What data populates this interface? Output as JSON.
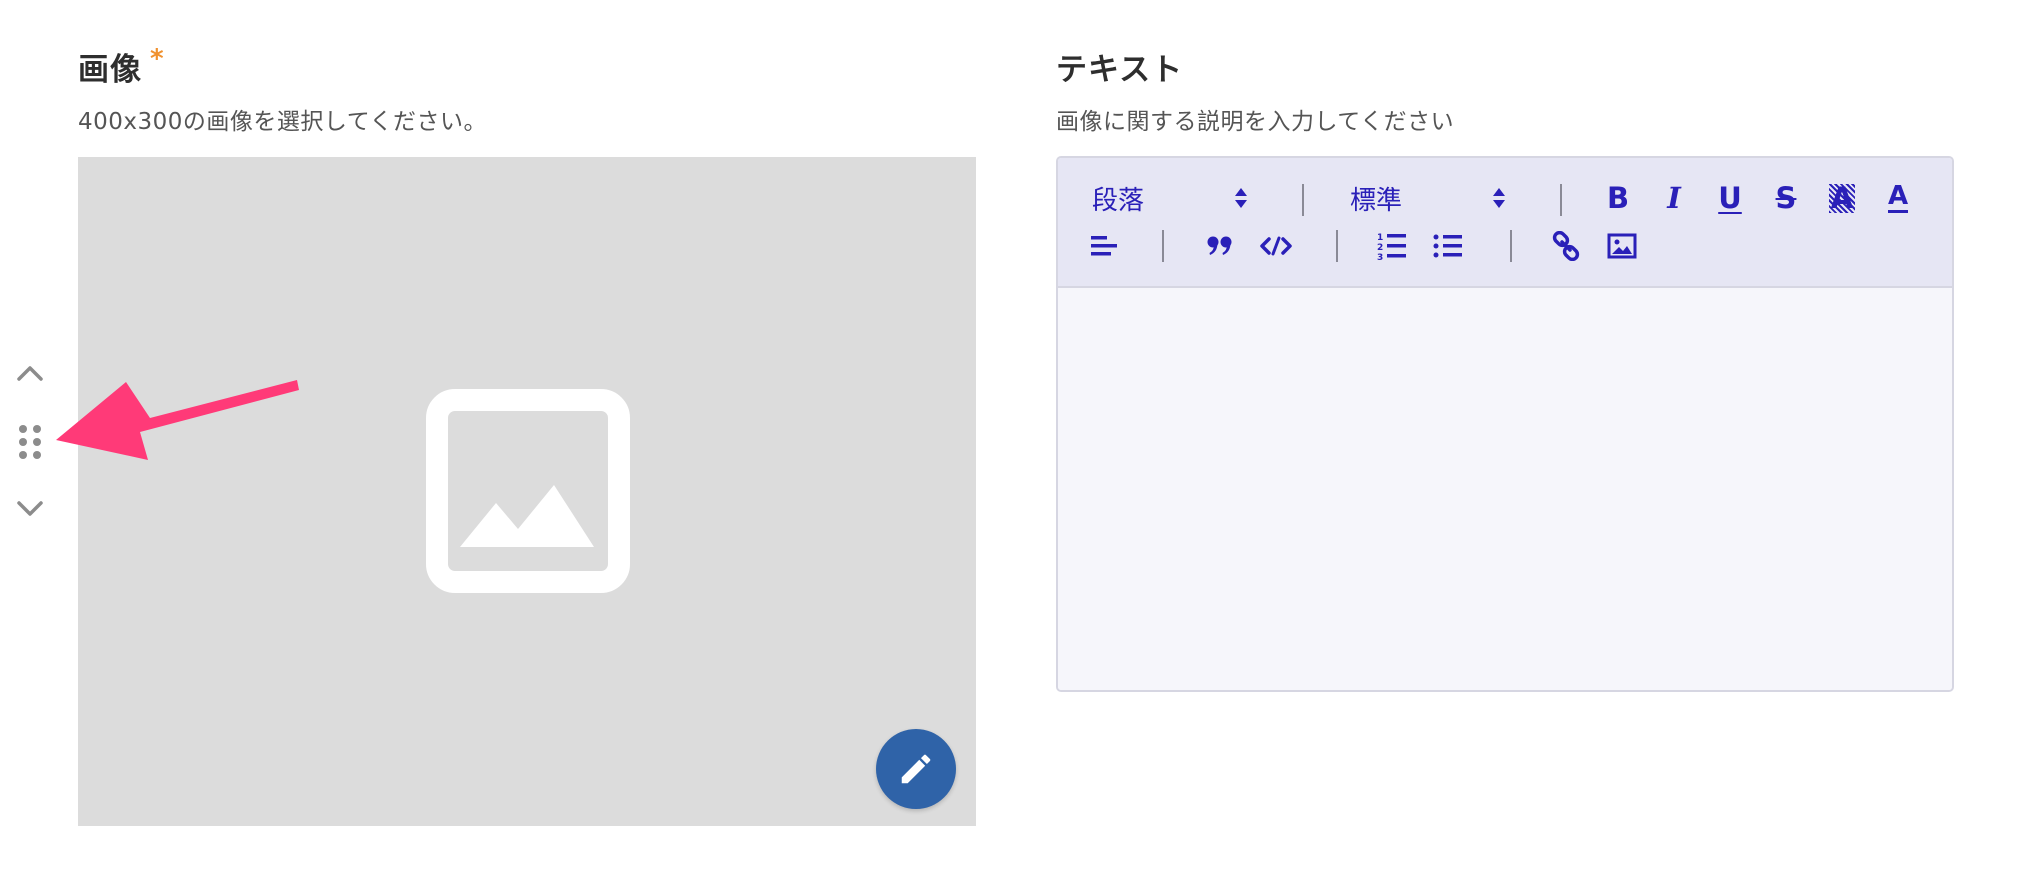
{
  "image_field": {
    "label": "画像",
    "required_mark": "*",
    "help": "400x300の画像を選択してください。"
  },
  "text_field": {
    "label": "テキスト",
    "help": "画像に関する説明を入力してください"
  },
  "toolbar": {
    "block_format_value": "段落",
    "font_size_value": "標準",
    "bold_glyph": "B",
    "italic_glyph": "I",
    "underline_glyph": "U",
    "strike_glyph": "S",
    "highlight_glyph": "A",
    "text_color_glyph": "A"
  },
  "icons": {
    "move_up": "chevron-up-icon",
    "drag": "drag-handle-icon",
    "move_down": "chevron-down-icon",
    "placeholder": "image-placeholder-icon",
    "edit": "pencil-icon"
  },
  "colors": {
    "accent": "#2f63a8",
    "toolbar_icon": "#2a20b8",
    "required": "#f0912e",
    "annotation": "#ff3a78",
    "image_bg": "#dcdcdc",
    "toolbar_bg": "#e6e6f4"
  }
}
